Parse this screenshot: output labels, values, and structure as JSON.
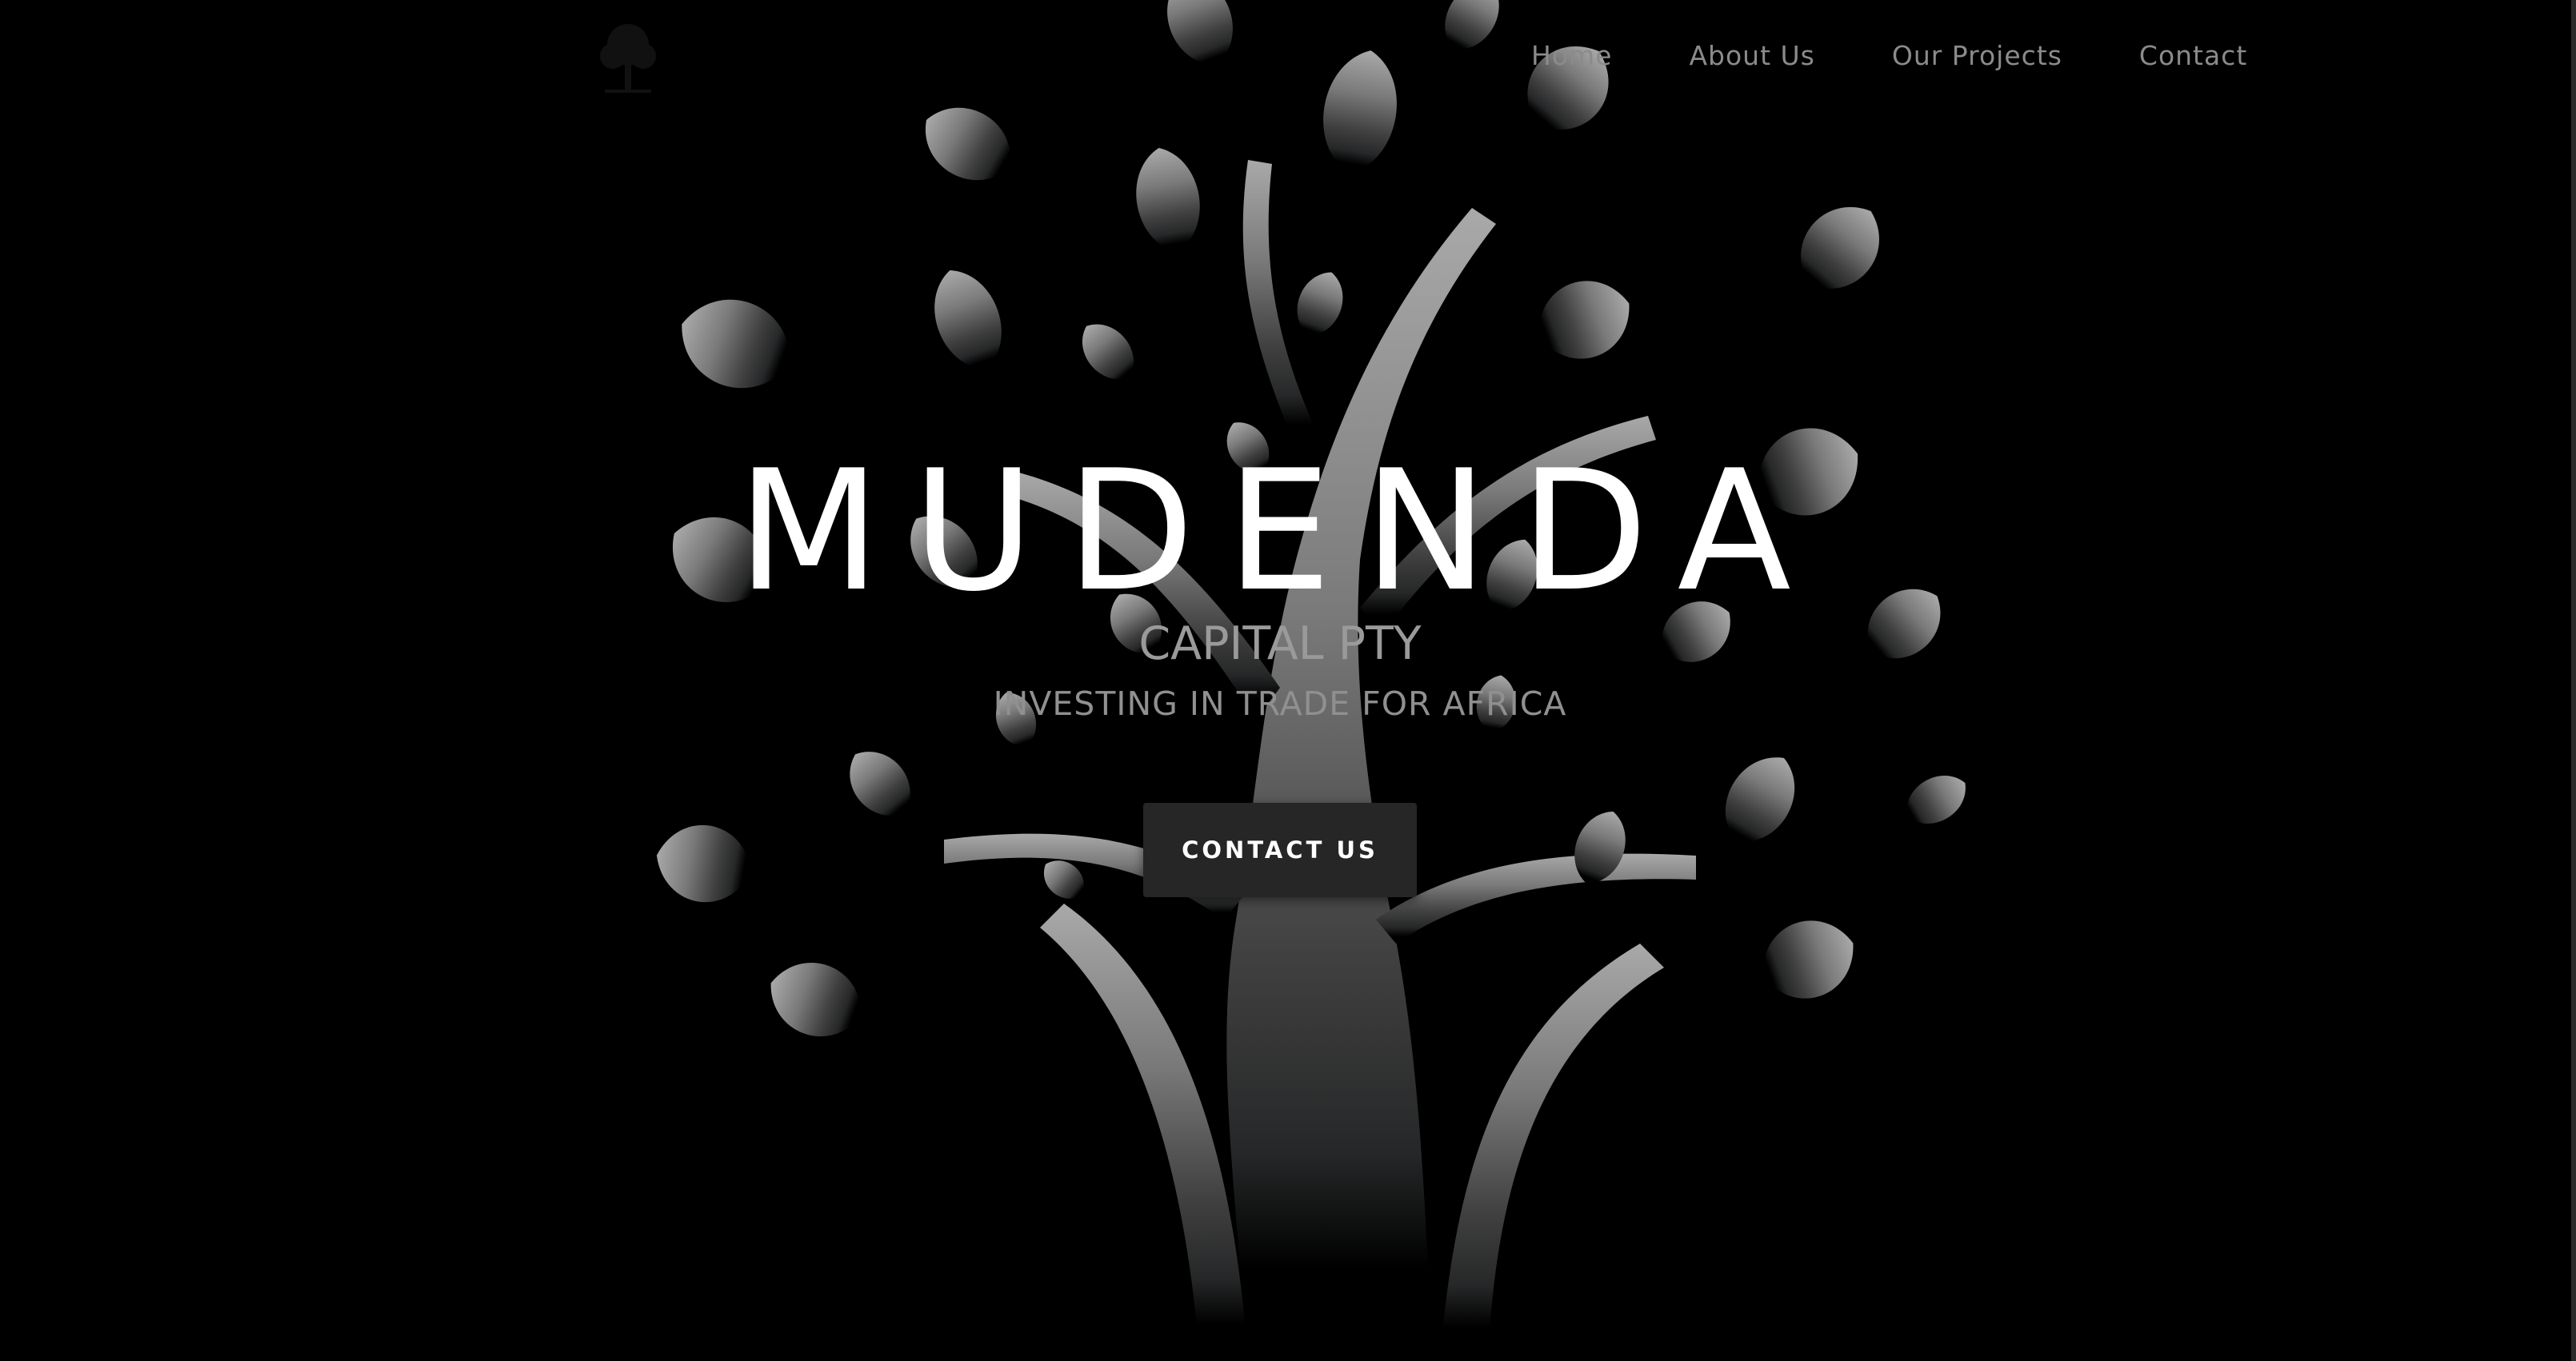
{
  "nav": {
    "logo_icon": "tree-icon",
    "links": [
      {
        "label": "Home"
      },
      {
        "label": "About Us"
      },
      {
        "label": "Our Projects"
      },
      {
        "label": "Contact"
      }
    ]
  },
  "hero": {
    "title": "MUDENDA",
    "subtitle": "CAPITAL PTY",
    "tagline": "INVESTING IN TRADE FOR AFRICA",
    "cta_label": "CONTACT US",
    "background_icon": "tree-illustration"
  },
  "colors": {
    "background": "#000000",
    "foliage_top": "#a6a6a6",
    "foliage_bottom": "#2b2b2b",
    "title": "#ffffff",
    "subtitle": "#9a9a9a",
    "nav_link": "#8b8b8b",
    "button": "#262626"
  }
}
